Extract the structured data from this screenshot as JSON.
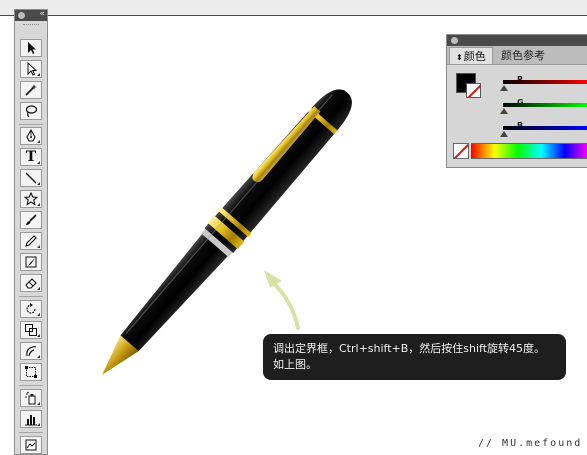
{
  "color_panel": {
    "tabs": [
      {
        "label": "颜色",
        "active": true
      },
      {
        "label": "颜色参考",
        "active": false
      }
    ],
    "channels": [
      {
        "label": "R",
        "gradient": [
          "#000000",
          "#ff0000"
        ]
      },
      {
        "label": "G",
        "gradient": [
          "#000000",
          "#00ff00"
        ]
      },
      {
        "label": "B",
        "gradient": [
          "#000000",
          "#0000ff"
        ]
      }
    ],
    "fill_color": "#000000",
    "stroke": "none"
  },
  "tools": [
    {
      "name": "selection-tool"
    },
    {
      "name": "direct-selection-tool"
    },
    {
      "name": "magic-wand-tool"
    },
    {
      "name": "lasso-tool"
    },
    {
      "name": "pen-tool"
    },
    {
      "name": "type-tool",
      "glyph": "T"
    },
    {
      "name": "line-tool"
    },
    {
      "name": "star-tool"
    },
    {
      "name": "paintbrush-tool"
    },
    {
      "name": "pencil-tool"
    },
    {
      "name": "blob-brush-tool"
    },
    {
      "name": "eraser-tool"
    },
    {
      "name": "rotate-tool"
    },
    {
      "name": "scale-tool"
    },
    {
      "name": "warp-tool"
    },
    {
      "name": "free-transform-tool"
    },
    {
      "name": "symbol-sprayer-tool"
    },
    {
      "name": "column-graph-tool"
    },
    {
      "name": "artboard-tool"
    }
  ],
  "callout": {
    "line1": "调出定界框，Ctrl+shift+B，然后按住shift旋转45度。",
    "line2": "如上图。"
  },
  "watermark": "// MU.mefound",
  "colors": {
    "pen_body": "#0a0a0a",
    "pen_gold": "#e7c21a",
    "callout_bg": "#1e1e1e",
    "arrow": "#d6e3a6"
  }
}
